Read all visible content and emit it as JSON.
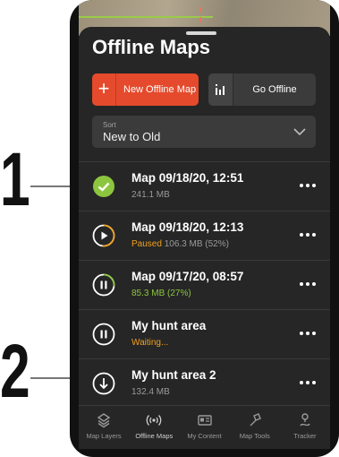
{
  "callouts": [
    "1",
    "2"
  ],
  "header": {
    "title": "Offline Maps"
  },
  "actions": {
    "new_map_label": "New Offline Map",
    "go_offline_label": "Go Offline"
  },
  "sort": {
    "caption": "Sort",
    "value": "New to Old"
  },
  "maps": [
    {
      "title": "Map 09/18/20, 12:51",
      "status": "",
      "detail": "241.1 MB",
      "state": "complete"
    },
    {
      "title": "Map 09/18/20, 12:13",
      "status": "Paused",
      "detail": "106.3 MB (52%)",
      "state": "paused",
      "progress": 0.52
    },
    {
      "title": "Map 09/17/20, 08:57",
      "status": "",
      "detail": "85.3 MB (27%)",
      "state": "downloading",
      "progress": 0.27
    },
    {
      "title": "My hunt area",
      "status": "",
      "detail": "Waiting...",
      "state": "waiting"
    },
    {
      "title": "My hunt area 2",
      "status": "",
      "detail": "132.4 MB",
      "state": "available"
    }
  ],
  "tabs": [
    {
      "label": "Map Layers",
      "icon": "map-layers-icon"
    },
    {
      "label": "Offline Maps",
      "icon": "offline-maps-icon"
    },
    {
      "label": "My Content",
      "icon": "my-content-icon"
    },
    {
      "label": "Map Tools",
      "icon": "map-tools-icon"
    },
    {
      "label": "Tracker",
      "icon": "tracker-icon"
    }
  ],
  "colors": {
    "accent": "#e54a2c",
    "complete": "#8cc63f",
    "paused": "#f0a020",
    "sheet": "#262626"
  }
}
